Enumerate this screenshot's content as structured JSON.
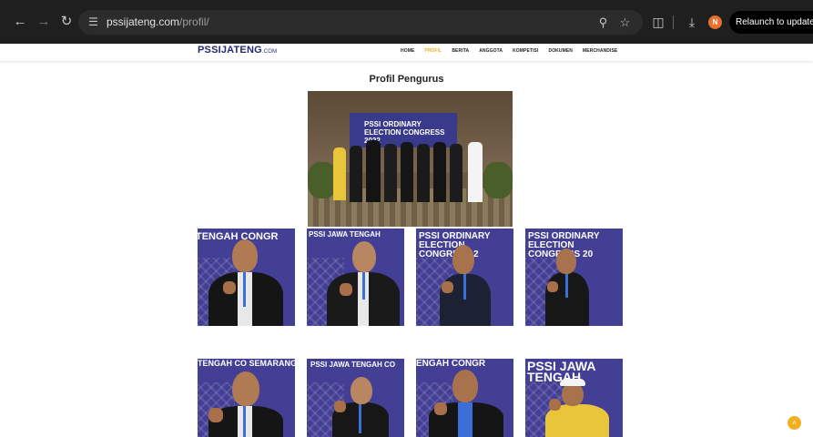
{
  "browser": {
    "url_host": "pssijateng.com",
    "url_path": "/profil/",
    "relaunch_label": "Relaunch to update",
    "profile_initial": "N"
  },
  "site": {
    "logo_main": "PSSIJATENG",
    "logo_suffix": ".COM",
    "menu": [
      {
        "label": "HOME",
        "active": false
      },
      {
        "label": "PROFIL",
        "active": true
      },
      {
        "label": "BERITA",
        "active": false
      },
      {
        "label": "ANGGOTA",
        "active": false
      },
      {
        "label": "KOMPETISI",
        "active": false
      },
      {
        "label": "DOKUMEN",
        "active": false
      },
      {
        "label": "MERCHANDISE",
        "active": false
      }
    ],
    "accent_color": "#f0b323",
    "brand_color": "#23296e"
  },
  "page": {
    "title": "Profil Pengurus",
    "group_photo_banner": "PSSI ORDINARY ELECTION CONGRESS 2022",
    "portrait_banners": [
      "TENGAH CONGR",
      "PSSI JAWA TENGAH",
      "PSSI ORDINARY ELECTION CONGRESS 2",
      "PSSI ORDINARY ELECTION CONGRESS 20",
      "TENGAH CO SEMARANG",
      "PSSI JAWA TENGAH CO",
      "ENGAH CONGR",
      "PSSI JAWA TENGAH"
    ]
  },
  "icons": {
    "back": "back-arrow-icon",
    "forward": "forward-arrow-icon",
    "reload": "reload-icon",
    "zoom": "zoom-icon",
    "bookmark": "star-icon",
    "extensions": "puzzle-icon",
    "download": "download-icon",
    "menu": "kebab-menu-icon",
    "scroll_top": "chevron-up-icon"
  }
}
